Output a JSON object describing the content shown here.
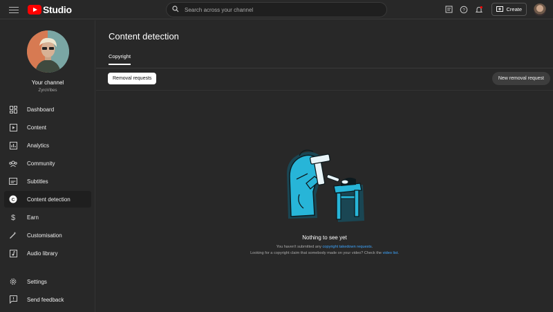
{
  "header": {
    "logo_text": "Studio",
    "search_placeholder": "Search across your channel",
    "create_label": "Create"
  },
  "channel": {
    "title": "Your channel",
    "handle": "ZyroVibes"
  },
  "sidebar": {
    "items": [
      {
        "label": "Dashboard",
        "icon": "dashboard-icon"
      },
      {
        "label": "Content",
        "icon": "content-icon"
      },
      {
        "label": "Analytics",
        "icon": "analytics-icon"
      },
      {
        "label": "Community",
        "icon": "community-icon"
      },
      {
        "label": "Subtitles",
        "icon": "subtitles-icon"
      },
      {
        "label": "Content detection",
        "icon": "content-detection-icon",
        "active": true
      },
      {
        "label": "Earn",
        "icon": "earn-icon"
      },
      {
        "label": "Customisation",
        "icon": "customisation-icon"
      },
      {
        "label": "Audio library",
        "icon": "audio-library-icon"
      }
    ],
    "footer": [
      {
        "label": "Settings",
        "icon": "gear-icon"
      },
      {
        "label": "Send feedback",
        "icon": "feedback-icon"
      }
    ]
  },
  "main": {
    "title": "Content detection",
    "tab": "Copyright",
    "filter_chip": "Removal requests",
    "new_request_label": "New removal request",
    "empty": {
      "title": "Nothing to see yet",
      "line1_prefix": "You haven't submitted any ",
      "line1_link": "copyright takedown requests",
      "line1_suffix": ".",
      "line2_prefix": "Looking for a copyright claim that somebody made on your video? Check the ",
      "line2_link": "video list",
      "line2_suffix": "."
    }
  },
  "colors": {
    "background": "#282828",
    "accent_link": "#3ea6ff",
    "illustration": "#27b5d8",
    "logo_red": "#ff0000"
  }
}
